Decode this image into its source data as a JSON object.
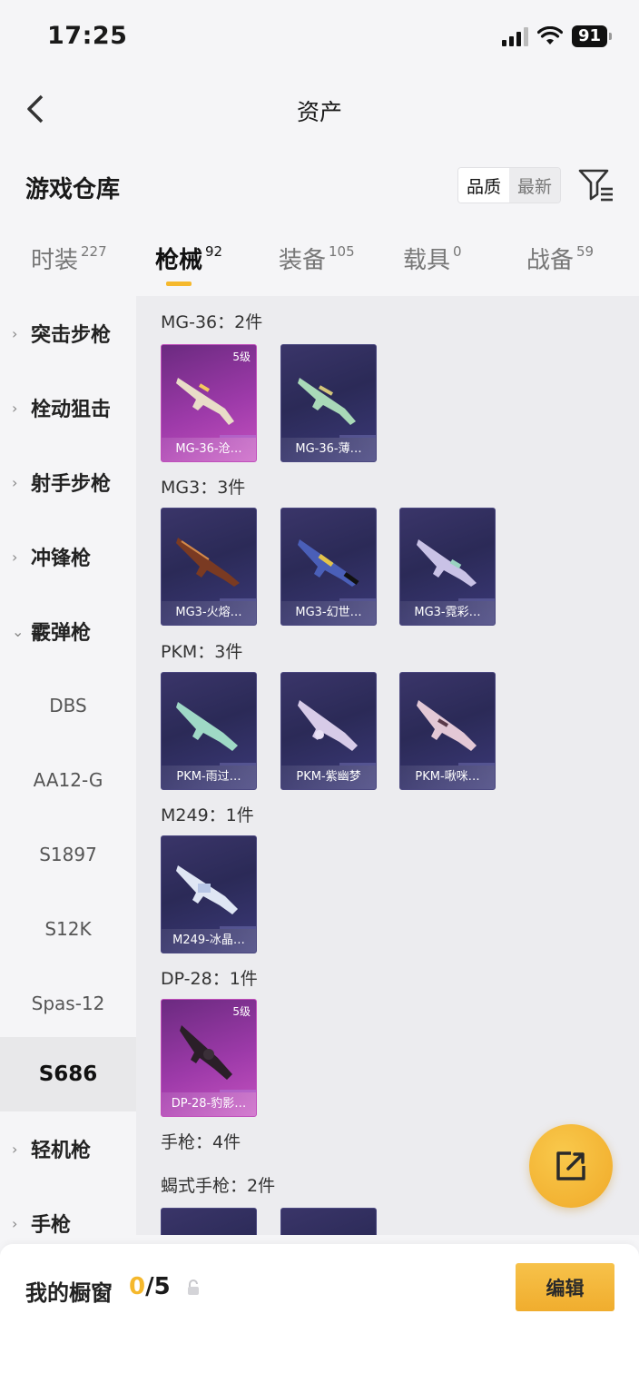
{
  "status_bar": {
    "time": "17:25",
    "battery": "91"
  },
  "nav": {
    "title": "资产"
  },
  "warehouse": {
    "title": "游戏仓库",
    "sort": [
      "品质",
      "最新"
    ]
  },
  "tabs": [
    {
      "label": "时装",
      "count": "227"
    },
    {
      "label": "枪械",
      "count": "92"
    },
    {
      "label": "装备",
      "count": "105"
    },
    {
      "label": "载具",
      "count": "0"
    },
    {
      "label": "战备",
      "count": "59"
    }
  ],
  "sidebar": [
    {
      "label": "突击步枪",
      "chevron": "›"
    },
    {
      "label": "栓动狙击",
      "chevron": "›"
    },
    {
      "label": "射手步枪",
      "chevron": "›"
    },
    {
      "label": "冲锋枪",
      "chevron": "›"
    },
    {
      "label": "霰弹枪",
      "chevron": "⌄"
    },
    {
      "label": "DBS"
    },
    {
      "label": "AA12-G"
    },
    {
      "label": "S1897"
    },
    {
      "label": "S12K"
    },
    {
      "label": "Spas-12"
    },
    {
      "label": "S686"
    },
    {
      "label": "轻机枪",
      "chevron": "›"
    },
    {
      "label": "手枪",
      "chevron": "›"
    }
  ],
  "groups": [
    {
      "title": "MG-36：2件",
      "items": [
        {
          "name": "MG-36-沧…",
          "level": "5级",
          "rarity": "pink"
        },
        {
          "name": "MG-36-薄…",
          "rarity": "purple"
        }
      ]
    },
    {
      "title": "MG3：3件",
      "items": [
        {
          "name": "MG3-火熔…",
          "rarity": "purple"
        },
        {
          "name": "MG3-幻世…",
          "rarity": "purple"
        },
        {
          "name": "MG3-霓彩…",
          "rarity": "purple"
        }
      ]
    },
    {
      "title": "PKM：3件",
      "items": [
        {
          "name": "PKM-雨过…",
          "rarity": "purple"
        },
        {
          "name": "PKM-紫幽梦",
          "rarity": "purple"
        },
        {
          "name": "PKM-啾咪…",
          "rarity": "purple"
        }
      ]
    },
    {
      "title": "M249：1件",
      "items": [
        {
          "name": "M249-冰晶…",
          "rarity": "purple"
        }
      ]
    },
    {
      "title": "DP-28：1件",
      "items": [
        {
          "name": "DP-28-豹影…",
          "level": "5级",
          "rarity": "pink"
        }
      ]
    }
  ],
  "pistol_section": {
    "title": "手枪：4件",
    "sub_title": "蝎式手枪：2件"
  },
  "showcase": {
    "label": "我的橱窗",
    "current": "0",
    "total": "/5",
    "edit_label": "编辑"
  },
  "colors": {
    "accent": "#f5b82c",
    "pink_card": "#b047b3",
    "purple_card": "#2f2d5e"
  }
}
